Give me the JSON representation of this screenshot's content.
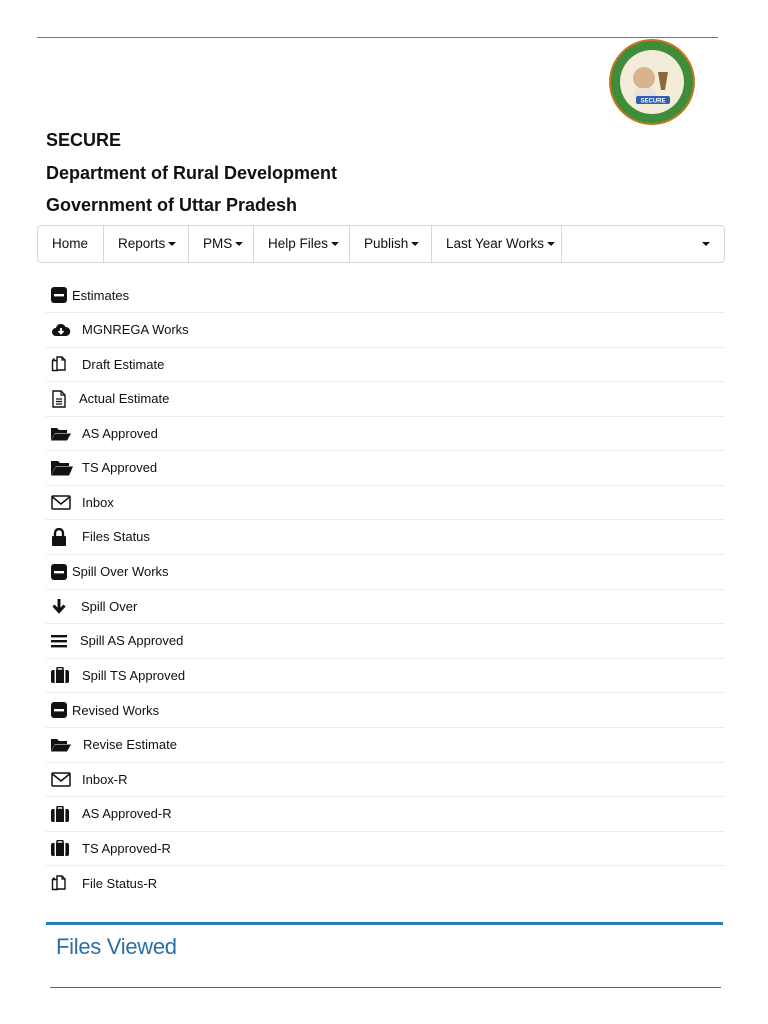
{
  "header": {
    "org": "SECURE",
    "department": "Department of Rural Development",
    "government": "Government of Uttar Pradesh",
    "logo_text": "SECURE"
  },
  "nav": {
    "home": "Home",
    "reports": "Reports",
    "pms": "PMS",
    "help_files": "Help Files",
    "publish": "Publish",
    "last_year_works": "Last Year Works"
  },
  "menu": {
    "estimates": "Estimates",
    "mgnrega_works": "MGNREGA Works",
    "draft_estimate": "Draft Estimate",
    "actual_estimate": "Actual Estimate",
    "as_approved": "AS Approved",
    "ts_approved": "TS Approved",
    "inbox": "Inbox",
    "files_status": "Files Status",
    "spill_over_works": "Spill Over Works",
    "spill_over": "Spill Over",
    "spill_as_approved": "Spill AS Approved",
    "spill_ts_approved": "Spill TS Approved",
    "revised_works": "Revised Works",
    "revise_estimate": "Revise Estimate",
    "inbox_r": "Inbox-R",
    "as_approved_r": "AS Approved-R",
    "ts_approved_r": "TS Approved-R",
    "file_status_r": "File Status-R"
  },
  "files_viewed": {
    "title": "Files Viewed"
  },
  "colors": {
    "accent_blue": "#2a6fa5",
    "rule_brown": "#b5652a",
    "rule_red": "#c0392b"
  }
}
